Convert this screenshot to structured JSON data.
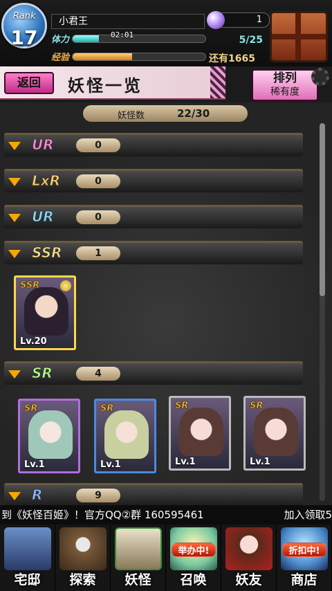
{
  "player": {
    "rank_word": "Rank",
    "rank": "17",
    "name": "小君王",
    "stamina_label": "体力",
    "stamina_timer": "02:01",
    "stamina_value": "5/25",
    "stamina_fraction": 0.2,
    "exp_label": "经验",
    "exp_remaining": "还有1665",
    "exp_fraction": 0.45,
    "orb_count": "1"
  },
  "header": {
    "back_label": "返回",
    "title": "妖怪一览",
    "sort_label": "排列",
    "sort_value": "稀有度"
  },
  "collection": {
    "count_label": "妖怪数",
    "count_value": "22/30"
  },
  "rarity_groups": [
    {
      "label": "UR",
      "count": "0",
      "color": "#ff8ad8"
    },
    {
      "label": "LxR",
      "count": "0",
      "color": "#ffd26a"
    },
    {
      "label": "UR",
      "count": "0",
      "color": "#8ad8ff"
    },
    {
      "label": "SSR",
      "count": "1",
      "color": "#ffe08a"
    },
    {
      "label": "SR",
      "count": "4",
      "color": "#b8ff8a"
    },
    {
      "label": "R",
      "count": "9",
      "color": "#8ab8ff"
    }
  ],
  "cards": [
    {
      "rarity": "SSR",
      "level": "Lv.20"
    },
    {
      "rarity": "SR",
      "level": "Lv.1"
    },
    {
      "rarity": "SR",
      "level": "Lv.1"
    },
    {
      "rarity": "SR",
      "level": "Lv.1"
    },
    {
      "rarity": "SR",
      "level": "Lv.1"
    }
  ],
  "ticker": {
    "message": "到《妖怪百姬》！官方QQ②群 160595461",
    "join": "加入领取5"
  },
  "nav": [
    {
      "label": "宅邸",
      "icon": "house-icon"
    },
    {
      "label": "探索",
      "icon": "magnifier-icon"
    },
    {
      "label": "妖怪",
      "icon": "scroll-icon"
    },
    {
      "label": "召唤",
      "icon": "summon-icon",
      "badge": "举办中!"
    },
    {
      "label": "妖友",
      "icon": "friend-icon"
    },
    {
      "label": "商店",
      "icon": "shop-icon",
      "badge": "折扣中!"
    }
  ]
}
